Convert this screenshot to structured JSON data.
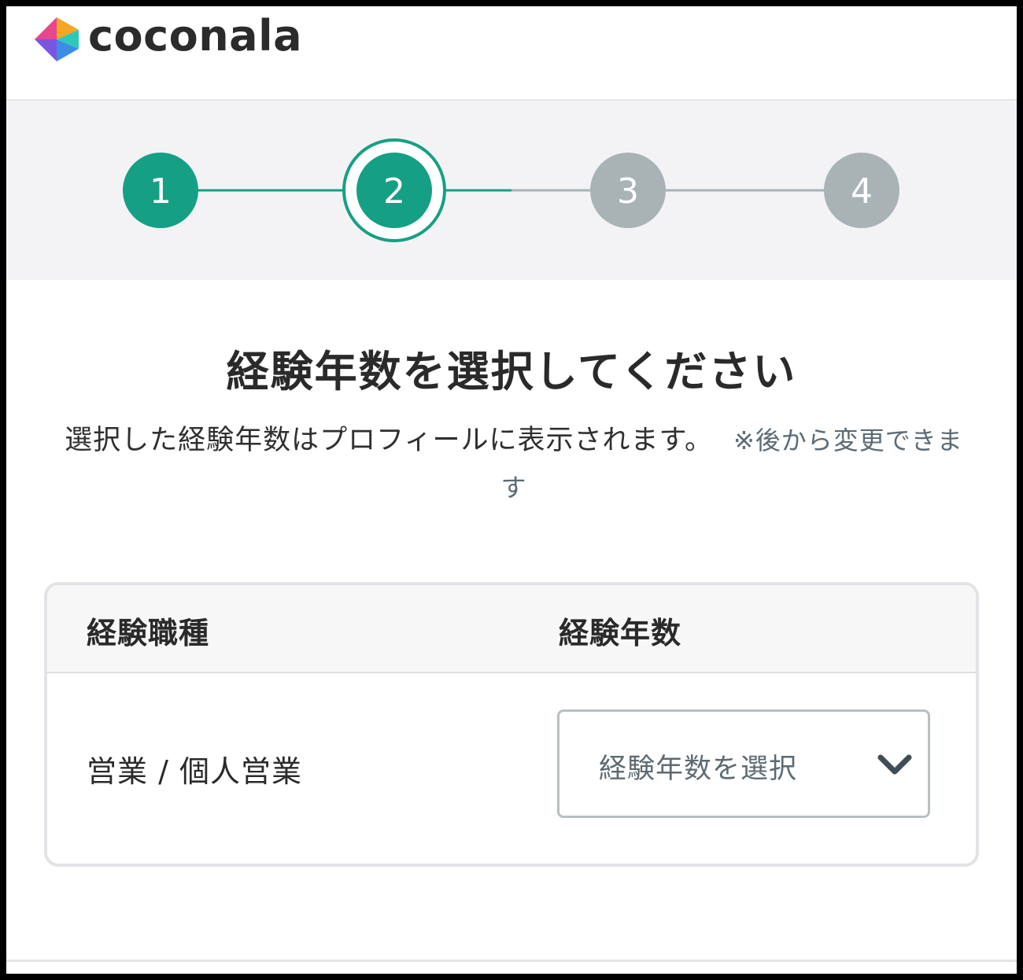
{
  "brand": {
    "name": "coconala",
    "colors": {
      "pink": "#e8478b",
      "purple": "#7b55e0",
      "blue": "#3b8de8",
      "orange": "#f5a623",
      "teal": "#2ec8b8"
    }
  },
  "stepper": {
    "steps": [
      {
        "number": "1",
        "status": "completed"
      },
      {
        "number": "2",
        "status": "current"
      },
      {
        "number": "3",
        "status": "upcoming"
      },
      {
        "number": "4",
        "status": "upcoming"
      }
    ],
    "colors": {
      "active": "#15a085",
      "inactive": "#a9b3b6"
    }
  },
  "page": {
    "title": "経験年数を選択してください",
    "description": "選択した経験年数はプロフィールに表示されます。",
    "note": "※後から変更できます"
  },
  "table": {
    "header_job": "経験職種",
    "header_years": "経験年数",
    "rows": [
      {
        "job": "営業 / 個人営業",
        "years_placeholder": "経験年数を選択"
      }
    ]
  },
  "icons": {
    "logo": "coconala-logo-icon",
    "select_chevron": "chevron-down-icon"
  }
}
